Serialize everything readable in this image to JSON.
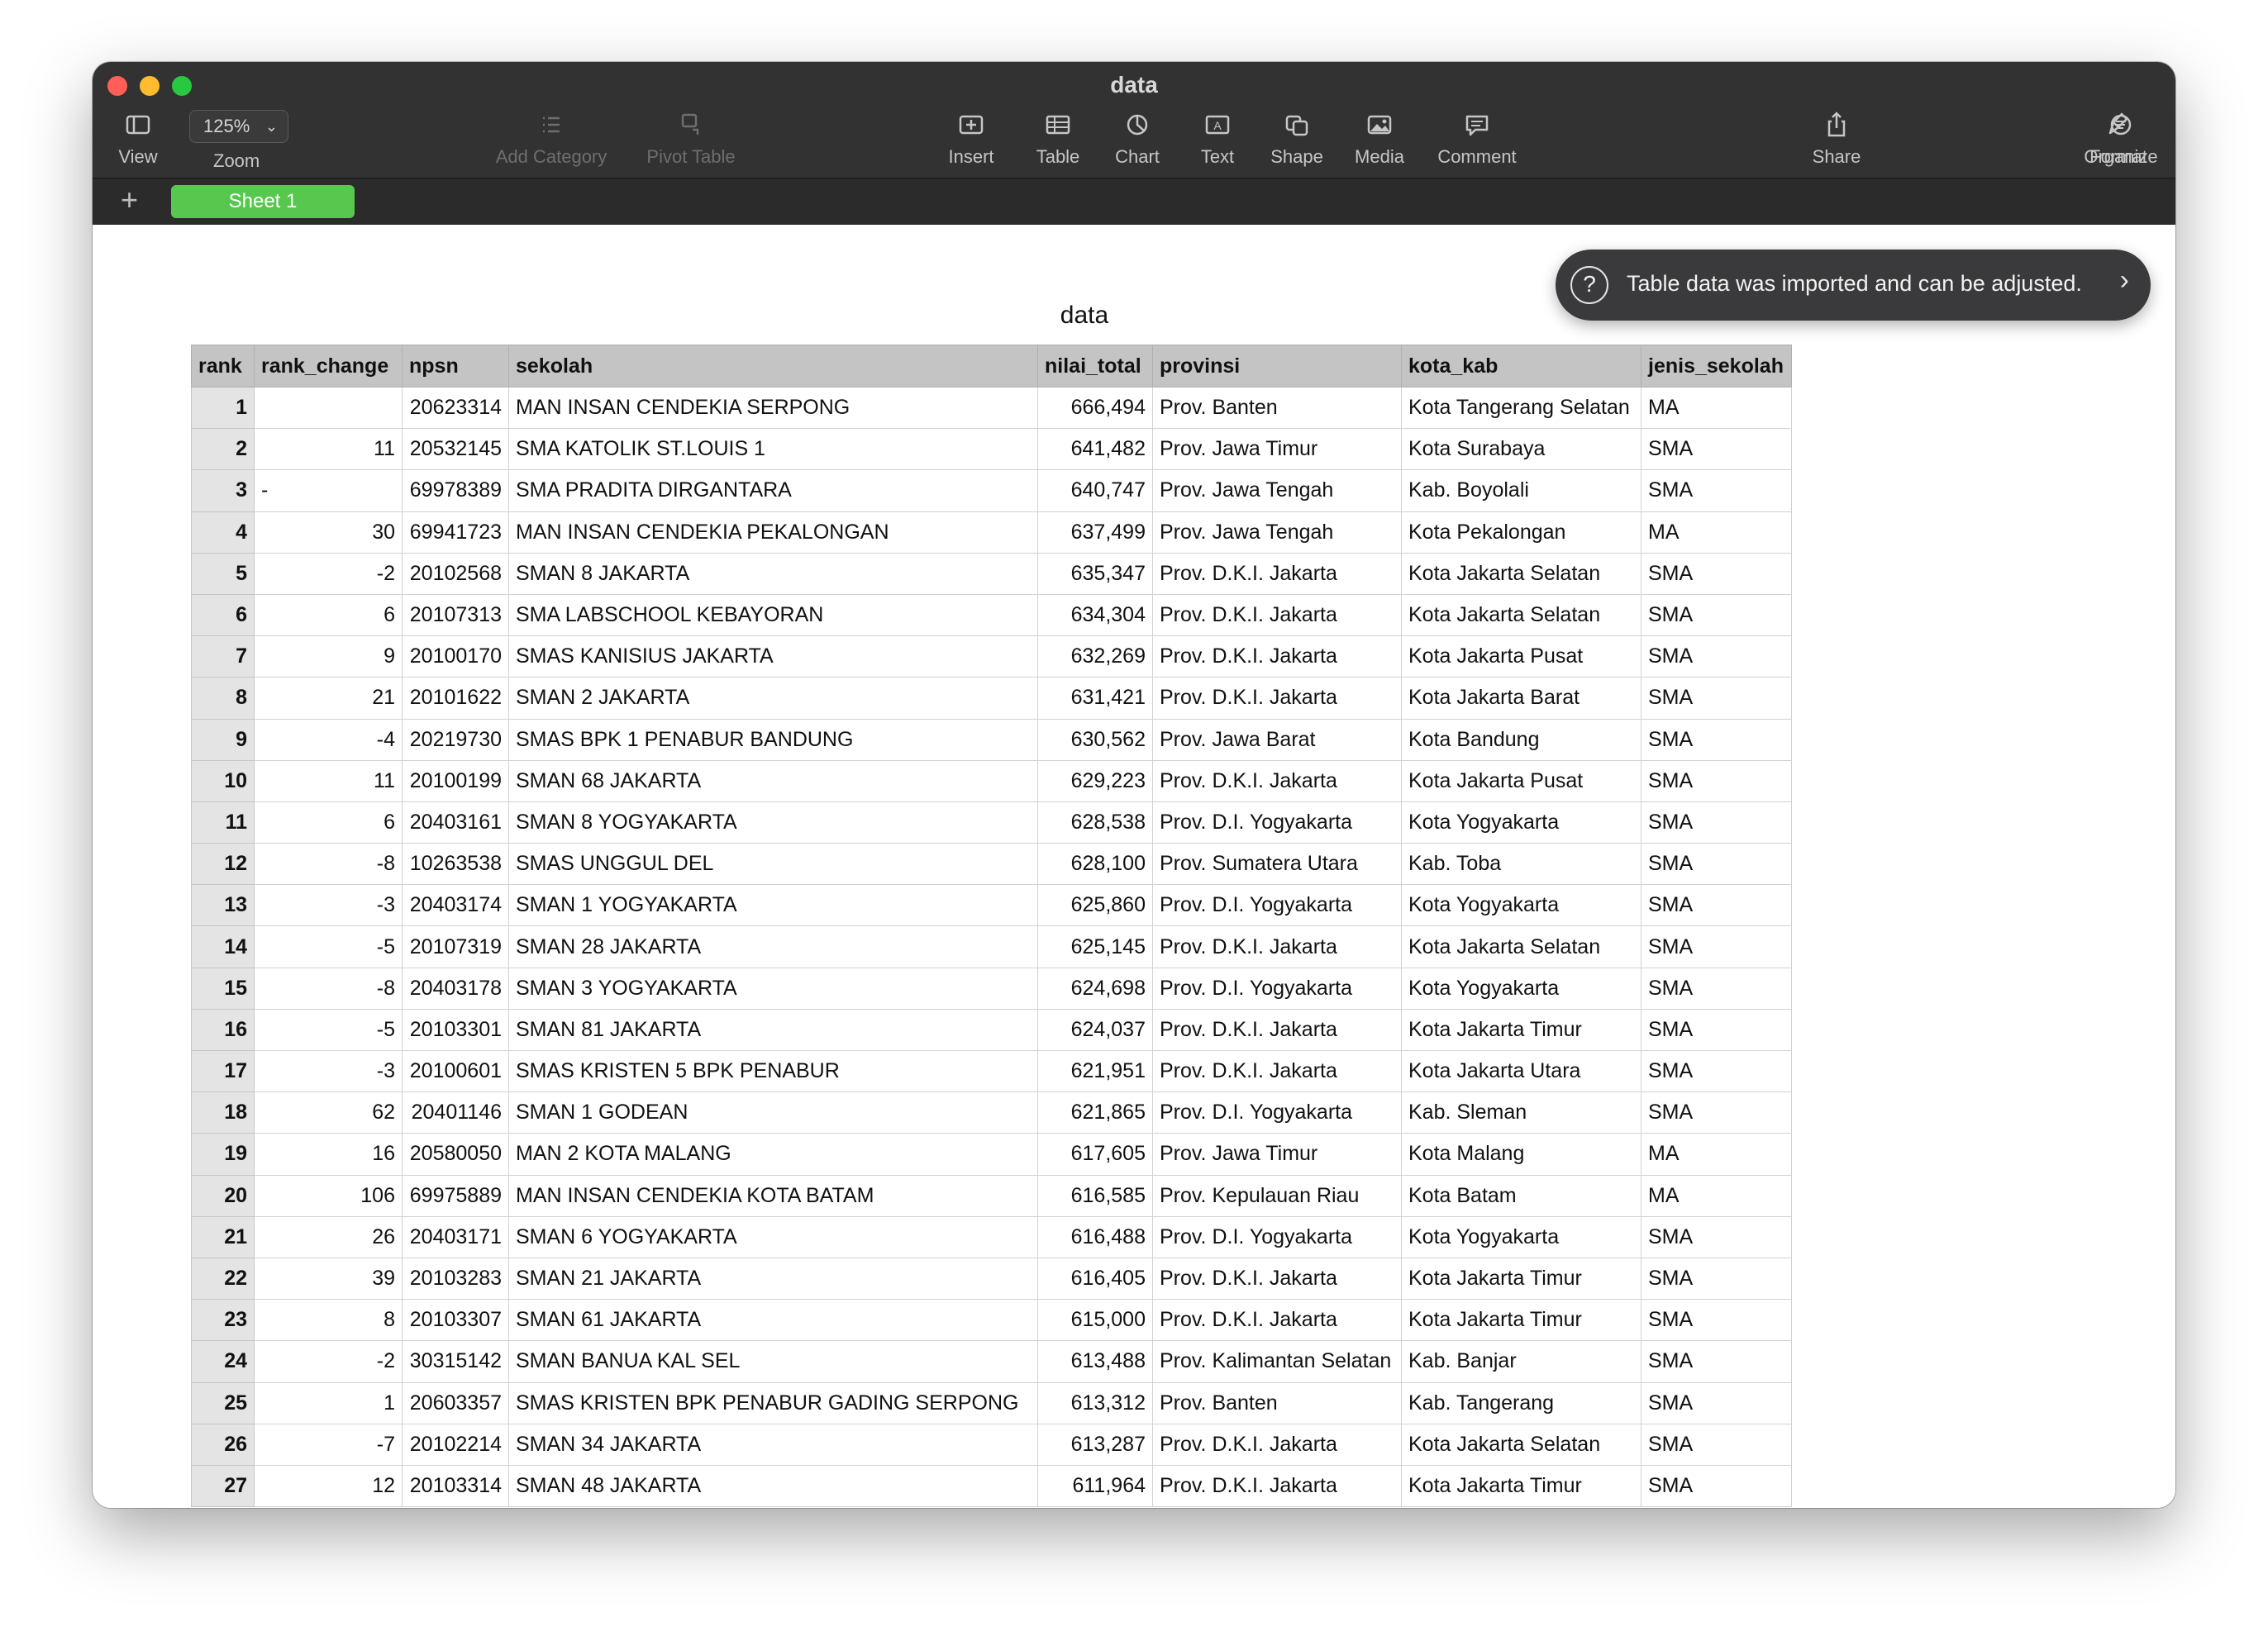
{
  "window": {
    "title": "data",
    "traffic_lights": [
      "#ff5f57",
      "#febc2e",
      "#28c840"
    ]
  },
  "toolbar": {
    "view": {
      "label": "View",
      "icon": "sidebar-icon"
    },
    "zoom": {
      "label": "Zoom",
      "value": "125%"
    },
    "add_category": {
      "label": "Add Category",
      "icon": "list-icon",
      "enabled": false
    },
    "pivot_table": {
      "label": "Pivot Table",
      "icon": "pivot-icon",
      "enabled": false
    },
    "insert": {
      "label": "Insert",
      "icon": "insert-icon"
    },
    "table": {
      "label": "Table",
      "icon": "table-icon"
    },
    "chart": {
      "label": "Chart",
      "icon": "chart-icon"
    },
    "text": {
      "label": "Text",
      "icon": "text-icon"
    },
    "shape": {
      "label": "Shape",
      "icon": "shape-icon"
    },
    "media": {
      "label": "Media",
      "icon": "media-icon"
    },
    "comment": {
      "label": "Comment",
      "icon": "comment-icon"
    },
    "share": {
      "label": "Share",
      "icon": "share-icon"
    },
    "format": {
      "label": "Format",
      "icon": "paintbrush-icon"
    },
    "organize": {
      "label": "Organize",
      "icon": "organize-icon"
    }
  },
  "sheets": {
    "add": "+",
    "tabs": [
      {
        "label": "Sheet 1",
        "active": true
      }
    ],
    "accent": "#57c84d"
  },
  "notification": {
    "text": "Table data was imported and can be adjusted.",
    "icon": "question-icon",
    "arrow": ">"
  },
  "table": {
    "title": "data",
    "columns": [
      "rank",
      "rank_change",
      "npsn",
      "sekolah",
      "nilai_total",
      "provinsi",
      "kota_kab",
      "jenis_sekolah"
    ],
    "rows": [
      [
        "1",
        "",
        "20623314",
        "MAN INSAN CENDEKIA SERPONG",
        "666,494",
        "Prov. Banten",
        "Kota Tangerang Selatan",
        "MA"
      ],
      [
        "2",
        "11",
        "20532145",
        "SMA KATOLIK ST.LOUIS 1",
        "641,482",
        "Prov. Jawa Timur",
        "Kota Surabaya",
        "SMA"
      ],
      [
        "3",
        "-",
        "69978389",
        "SMA PRADITA DIRGANTARA",
        "640,747",
        "Prov. Jawa Tengah",
        "Kab. Boyolali",
        "SMA"
      ],
      [
        "4",
        "30",
        "69941723",
        "MAN INSAN CENDEKIA PEKALONGAN",
        "637,499",
        "Prov. Jawa Tengah",
        "Kota Pekalongan",
        "MA"
      ],
      [
        "5",
        "-2",
        "20102568",
        "SMAN 8 JAKARTA",
        "635,347",
        "Prov. D.K.I. Jakarta",
        "Kota Jakarta Selatan",
        "SMA"
      ],
      [
        "6",
        "6",
        "20107313",
        "SMA LABSCHOOL KEBAYORAN",
        "634,304",
        "Prov. D.K.I. Jakarta",
        "Kota Jakarta Selatan",
        "SMA"
      ],
      [
        "7",
        "9",
        "20100170",
        "SMAS KANISIUS JAKARTA",
        "632,269",
        "Prov. D.K.I. Jakarta",
        "Kota Jakarta Pusat",
        "SMA"
      ],
      [
        "8",
        "21",
        "20101622",
        "SMAN 2 JAKARTA",
        "631,421",
        "Prov. D.K.I. Jakarta",
        "Kota Jakarta Barat",
        "SMA"
      ],
      [
        "9",
        "-4",
        "20219730",
        "SMAS BPK 1 PENABUR BANDUNG",
        "630,562",
        "Prov. Jawa Barat",
        "Kota Bandung",
        "SMA"
      ],
      [
        "10",
        "11",
        "20100199",
        "SMAN 68 JAKARTA",
        "629,223",
        "Prov. D.K.I. Jakarta",
        "Kota Jakarta Pusat",
        "SMA"
      ],
      [
        "11",
        "6",
        "20403161",
        "SMAN 8 YOGYAKARTA",
        "628,538",
        "Prov. D.I. Yogyakarta",
        "Kota Yogyakarta",
        "SMA"
      ],
      [
        "12",
        "-8",
        "10263538",
        "SMAS UNGGUL DEL",
        "628,100",
        "Prov. Sumatera Utara",
        "Kab. Toba",
        "SMA"
      ],
      [
        "13",
        "-3",
        "20403174",
        "SMAN 1 YOGYAKARTA",
        "625,860",
        "Prov. D.I. Yogyakarta",
        "Kota Yogyakarta",
        "SMA"
      ],
      [
        "14",
        "-5",
        "20107319",
        "SMAN 28 JAKARTA",
        "625,145",
        "Prov. D.K.I. Jakarta",
        "Kota Jakarta Selatan",
        "SMA"
      ],
      [
        "15",
        "-8",
        "20403178",
        "SMAN 3 YOGYAKARTA",
        "624,698",
        "Prov. D.I. Yogyakarta",
        "Kota Yogyakarta",
        "SMA"
      ],
      [
        "16",
        "-5",
        "20103301",
        "SMAN 81 JAKARTA",
        "624,037",
        "Prov. D.K.I. Jakarta",
        "Kota Jakarta Timur",
        "SMA"
      ],
      [
        "17",
        "-3",
        "20100601",
        "SMAS KRISTEN 5 BPK PENABUR",
        "621,951",
        "Prov. D.K.I. Jakarta",
        "Kota Jakarta Utara",
        "SMA"
      ],
      [
        "18",
        "62",
        "20401146",
        "SMAN 1 GODEAN",
        "621,865",
        "Prov. D.I. Yogyakarta",
        "Kab. Sleman",
        "SMA"
      ],
      [
        "19",
        "16",
        "20580050",
        "MAN 2 KOTA MALANG",
        "617,605",
        "Prov. Jawa Timur",
        "Kota Malang",
        "MA"
      ],
      [
        "20",
        "106",
        "69975889",
        "MAN INSAN CENDEKIA KOTA BATAM",
        "616,585",
        "Prov. Kepulauan Riau",
        "Kota Batam",
        "MA"
      ],
      [
        "21",
        "26",
        "20403171",
        "SMAN 6 YOGYAKARTA",
        "616,488",
        "Prov. D.I. Yogyakarta",
        "Kota Yogyakarta",
        "SMA"
      ],
      [
        "22",
        "39",
        "20103283",
        "SMAN 21 JAKARTA",
        "616,405",
        "Prov. D.K.I. Jakarta",
        "Kota Jakarta Timur",
        "SMA"
      ],
      [
        "23",
        "8",
        "20103307",
        "SMAN 61 JAKARTA",
        "615,000",
        "Prov. D.K.I. Jakarta",
        "Kota Jakarta Timur",
        "SMA"
      ],
      [
        "24",
        "-2",
        "30315142",
        "SMAN BANUA KAL SEL",
        "613,488",
        "Prov. Kalimantan Selatan",
        "Kab. Banjar",
        "SMA"
      ],
      [
        "25",
        "1",
        "20603357",
        "SMAS KRISTEN BPK PENABUR GADING SERPONG",
        "613,312",
        "Prov. Banten",
        "Kab. Tangerang",
        "SMA"
      ],
      [
        "26",
        "-7",
        "20102214",
        "SMAN 34 JAKARTA",
        "613,287",
        "Prov. D.K.I. Jakarta",
        "Kota Jakarta Selatan",
        "SMA"
      ],
      [
        "27",
        "12",
        "20103314",
        "SMAN 48 JAKARTA",
        "611,964",
        "Prov. D.K.I. Jakarta",
        "Kota Jakarta Timur",
        "SMA"
      ]
    ]
  }
}
